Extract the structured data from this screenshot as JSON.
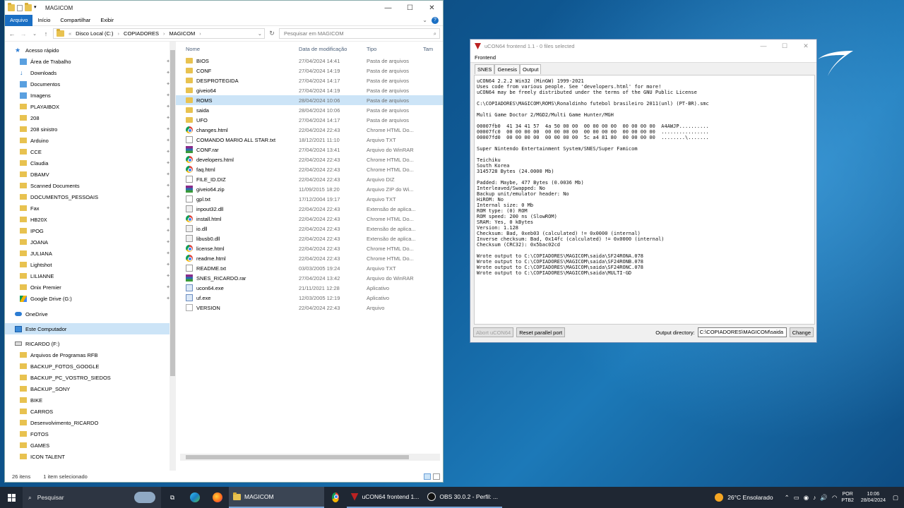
{
  "explorer": {
    "window_title": "MAGICOM",
    "ribbon_tabs": [
      "Arquivo",
      "Início",
      "Compartilhar",
      "Exibir"
    ],
    "breadcrumb": [
      "Disco Local (C:)",
      "COPIADORES",
      "MAGICOM"
    ],
    "search_placeholder": "Pesquisar em MAGICOM",
    "nav_quick_access": "Acesso rápido",
    "nav_items": [
      {
        "label": "Área de Trabalho",
        "icon": "desktop-icon"
      },
      {
        "label": "Downloads",
        "icon": "download-icon"
      },
      {
        "label": "Documentos",
        "icon": "documents-icon"
      },
      {
        "label": "Imagens",
        "icon": "images-icon"
      },
      {
        "label": "PLAYAIBOX",
        "icon": "folder-icon"
      },
      {
        "label": "208",
        "icon": "folder-icon"
      },
      {
        "label": "208 sinistro",
        "icon": "folder-icon"
      },
      {
        "label": "Arduino",
        "icon": "folder-icon"
      },
      {
        "label": "CCE",
        "icon": "folder-icon"
      },
      {
        "label": "Claudia",
        "icon": "folder-icon"
      },
      {
        "label": "DBAMV",
        "icon": "folder-icon"
      },
      {
        "label": "Scanned Documents",
        "icon": "folder-icon"
      },
      {
        "label": "DOCUMENTOS_PESSOAIS",
        "icon": "folder-icon"
      },
      {
        "label": "Fax",
        "icon": "folder-icon"
      },
      {
        "label": "HB20X",
        "icon": "folder-icon"
      },
      {
        "label": "IPOG",
        "icon": "folder-icon"
      },
      {
        "label": "JOANA",
        "icon": "folder-icon"
      },
      {
        "label": "JULIANA",
        "icon": "folder-icon"
      },
      {
        "label": "Lightshot",
        "icon": "folder-icon"
      },
      {
        "label": "LILIANNE",
        "icon": "folder-icon"
      },
      {
        "label": "Onix Premier",
        "icon": "folder-icon"
      },
      {
        "label": "Google Drive (G:)",
        "icon": "google-drive-icon"
      }
    ],
    "nav_onedrive": "OneDrive",
    "nav_this_pc": "Este Computador",
    "nav_drive": "RICARDO (F:)",
    "nav_drive_items": [
      "Arquivos de Programas RFB",
      "BACKUP_FOTOS_GOOGLE",
      "BACKUP_PC_VOSTRO_SIEDOS",
      "BACKUP_SONY",
      "BIKE",
      "CARROS",
      "Desenvolvimento_RICARDO",
      "FOTOS",
      "GAMES",
      "ICON TALENT"
    ],
    "columns": [
      "Nome",
      "Data de modificação",
      "Tipo",
      "Tam"
    ],
    "files": [
      {
        "name": "BIOS",
        "date": "27/04/2024 14:41",
        "type": "Pasta de arquivos",
        "icon": "folder"
      },
      {
        "name": "CONF",
        "date": "27/04/2024 14:19",
        "type": "Pasta de arquivos",
        "icon": "folder"
      },
      {
        "name": "DESPROTEGIDA",
        "date": "27/04/2024 14:17",
        "type": "Pasta de arquivos",
        "icon": "folder"
      },
      {
        "name": "giveio64",
        "date": "27/04/2024 14:19",
        "type": "Pasta de arquivos",
        "icon": "folder"
      },
      {
        "name": "ROMS",
        "date": "28/04/2024 10:06",
        "type": "Pasta de arquivos",
        "icon": "folder",
        "selected": true
      },
      {
        "name": "saida",
        "date": "28/04/2024 10:06",
        "type": "Pasta de arquivos",
        "icon": "folder"
      },
      {
        "name": "UFO",
        "date": "27/04/2024 14:17",
        "type": "Pasta de arquivos",
        "icon": "folder"
      },
      {
        "name": "changes.html",
        "date": "22/04/2024 22:43",
        "type": "Chrome HTML Do...",
        "icon": "chrome"
      },
      {
        "name": "COMANDO MARIO ALL STAR.txt",
        "date": "18/12/2021 11:10",
        "type": "Arquivo TXT",
        "icon": "txt"
      },
      {
        "name": "CONF.rar",
        "date": "27/04/2024 13:41",
        "type": "Arquivo do WinRAR",
        "icon": "rar"
      },
      {
        "name": "developers.html",
        "date": "22/04/2024 22:43",
        "type": "Chrome HTML Do...",
        "icon": "chrome"
      },
      {
        "name": "faq.html",
        "date": "22/04/2024 22:43",
        "type": "Chrome HTML Do...",
        "icon": "chrome"
      },
      {
        "name": "FILE_ID.DIZ",
        "date": "22/04/2024 22:43",
        "type": "Arquivo DIZ",
        "icon": "diz"
      },
      {
        "name": "giveio64.zip",
        "date": "11/09/2015 18:20",
        "type": "Arquivo ZIP do Wi...",
        "icon": "zip"
      },
      {
        "name": "gpl.txt",
        "date": "17/12/2004 19:17",
        "type": "Arquivo TXT",
        "icon": "txt"
      },
      {
        "name": "inpout32.dll",
        "date": "22/04/2024 22:43",
        "type": "Extensão de aplica...",
        "icon": "dll"
      },
      {
        "name": "install.html",
        "date": "22/04/2024 22:43",
        "type": "Chrome HTML Do...",
        "icon": "chrome"
      },
      {
        "name": "io.dll",
        "date": "22/04/2024 22:43",
        "type": "Extensão de aplica...",
        "icon": "dll"
      },
      {
        "name": "libusb0.dll",
        "date": "22/04/2024 22:43",
        "type": "Extensão de aplica...",
        "icon": "dll"
      },
      {
        "name": "license.html",
        "date": "22/04/2024 22:43",
        "type": "Chrome HTML Do...",
        "icon": "chrome"
      },
      {
        "name": "readme.html",
        "date": "22/04/2024 22:43",
        "type": "Chrome HTML Do...",
        "icon": "chrome"
      },
      {
        "name": "README.txt",
        "date": "03/03/2005 19:24",
        "type": "Arquivo TXT",
        "icon": "txt"
      },
      {
        "name": "SNES_RICARDO.rar",
        "date": "27/04/2024 13:42",
        "type": "Arquivo do WinRAR",
        "icon": "rar"
      },
      {
        "name": "ucon64.exe",
        "date": "21/11/2021 12:28",
        "type": "Aplicativo",
        "icon": "exe"
      },
      {
        "name": "uf.exe",
        "date": "12/03/2005 12:19",
        "type": "Aplicativo",
        "icon": "exe"
      },
      {
        "name": "VERSION",
        "date": "22/04/2024 22:43",
        "type": "Arquivo",
        "icon": "file"
      }
    ],
    "status_count": "26 itens",
    "status_selected": "1 item selecionado"
  },
  "ucon": {
    "window_title": "uCON64 frontend 1.1 - 0 files selected",
    "menu": "Frontend",
    "tabs": [
      "SNES",
      "Genesis",
      "Output"
    ],
    "output_text": "uCON64 2.2.2 Win32 (MinGW) 1999-2021\nUses code from various people. See 'developers.html' for more!\nuCON64 may be freely distributed under the terms of the GNU Public License\n\nC:\\COPIADORES\\MAGICOM\\ROMS\\Ronaldinho futebol brasileiro 2011(unl) (PT-BR).smc\n\nMulti Game Doctor 2/MGD2/Multi Game Hunter/MGH\n\n00007fb0  41 34 41 57  4a 50 00 00  00 00 00 00  00 00 00 00  A4AWJP..........\n00007fc0  00 00 00 00  00 00 00 00  00 00 00 00  00 00 00 00  ................\n00007fd0  00 00 00 00  00 00 00 00  5c a4 81 80  00 00 00 00  ........\\.......\n\nSuper Nintendo Entertainment System/SNES/Super Famicom\n\nTeichiku\nSouth Korea\n3145728 Bytes (24.0000 Mb)\n\nPadded: Maybe, 477 Bytes (0.0036 Mb)\nInterleaved/Swapped: No\nBackup unit/emulator header: No\nHiROM: No\nInternal size: 0 Mb\nROM type: (0) ROM\nROM speed: 200 ns (SlowROM)\nSRAM: Yes, 0 kBytes\nVersion: 1.128\nChecksum: Bad, 0xeb03 (calculated) != 0x0000 (internal)\nInverse checksum: Bad, 0x14fc (calculated) != 0x0000 (internal)\nChecksum (CRC32): 0x5bac02cd\n\nWrote output to C:\\COPIADORES\\MAGICOM\\saida\\SF24RONA.078\nWrote output to C:\\COPIADORES\\MAGICOM\\saida\\SF24RONB.078\nWrote output to C:\\COPIADORES\\MAGICOM\\saida\\SF24RONC.078\nWrote output to C:\\COPIADORES\\MAGICOM\\saida\\MULTI-GD",
    "abort_label": "Abort uCON64",
    "reset_label": "Reset parallel port",
    "outdir_label": "Output directory:",
    "outdir_value": "C:\\COPIADORES\\MAGICOM\\saida",
    "change_label": "Change"
  },
  "taskbar": {
    "search_label": "Pesquisar",
    "apps": [
      {
        "label": "MAGICOM",
        "icon": "folder-icon"
      },
      {
        "label": "uCON64 frontend 1...",
        "icon": "ucon64-icon"
      },
      {
        "label": "OBS 30.0.2 - Perfil: ...",
        "icon": "obs-icon"
      }
    ],
    "weather": "26°C Ensolarado",
    "lang": "POR",
    "lang2": "PTB2",
    "time": "10:06",
    "date": "28/04/2024"
  }
}
